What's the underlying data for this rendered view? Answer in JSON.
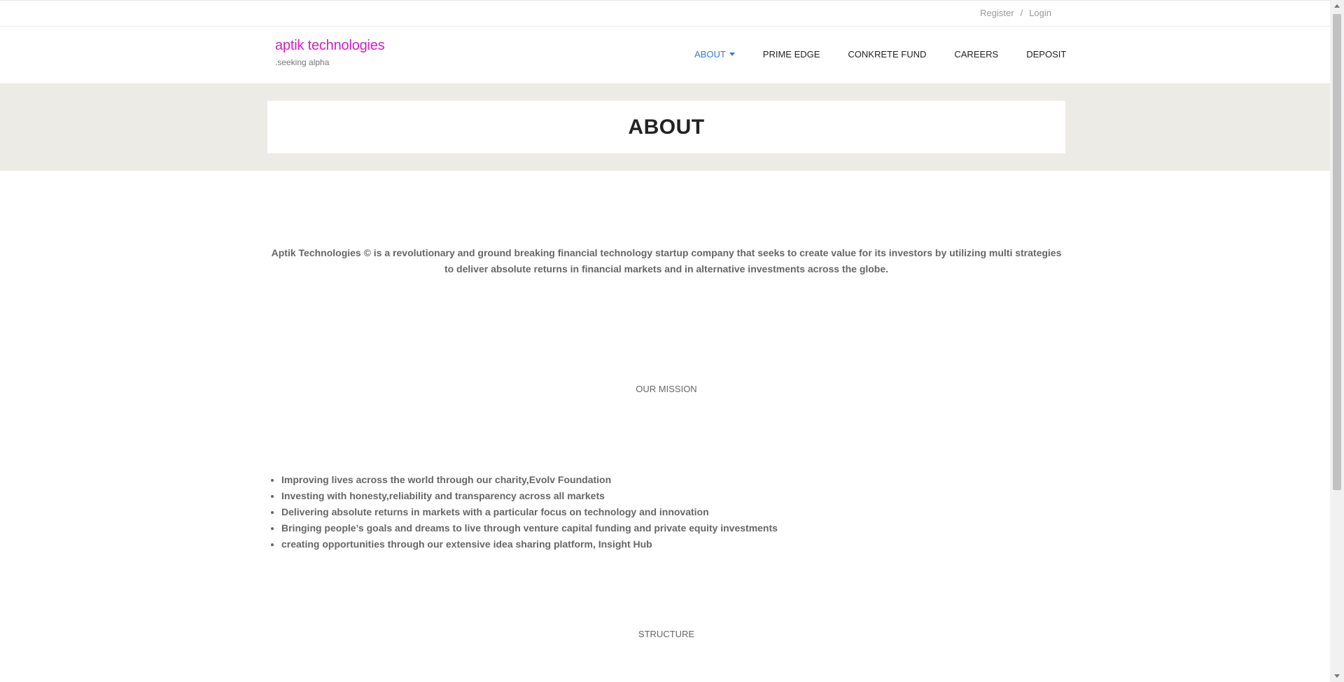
{
  "topbar": {
    "register": "Register",
    "separator": "/",
    "login": "Login"
  },
  "logo": {
    "name": "aptik technologies",
    "tagline": ".seeking alpha",
    "color": "#cc22c4"
  },
  "nav": {
    "items": [
      {
        "label": "ABOUT",
        "active": true,
        "dropdown": true
      },
      {
        "label": "PRIME EDGE"
      },
      {
        "label": "CONKRETE FUND"
      },
      {
        "label": "CAREERS"
      },
      {
        "label": "DEPOSIT"
      }
    ],
    "active_color": "#3b78d8"
  },
  "banner": {
    "title": "ABOUT",
    "background": "#ecebe5"
  },
  "content": {
    "intro": "Aptik Technologies © is a revolutionary and ground breaking financial technology startup company that seeks to create value for its investors by utilizing multi strategies to deliver absolute returns in financial markets and in alternative investments across the globe.",
    "mission_heading": "OUR MISSION",
    "mission_items": [
      " Improving lives across the world through our charity,Evolv Foundation",
      "Investing with honesty,reliability and transparency across all markets",
      "Delivering absolute returns in markets with a particular focus on technology and innovation",
      "Bringing people’s goals and dreams to live through venture capital funding and private equity investments",
      "creating opportunities through our extensive idea sharing platform, Insight Hub"
    ],
    "structure_heading": "STRUCTURE"
  }
}
